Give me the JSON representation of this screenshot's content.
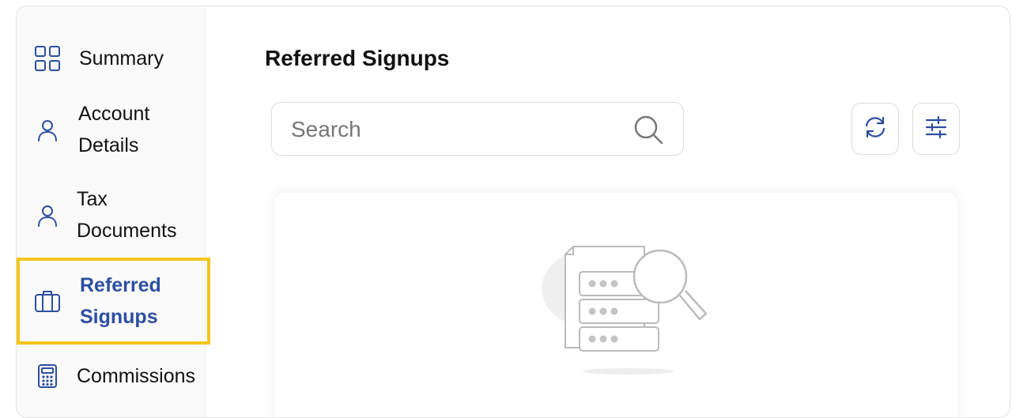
{
  "sidebar": {
    "items": [
      {
        "label": "Summary",
        "icon": "grid-icon"
      },
      {
        "label": "Account Details",
        "icon": "user-icon"
      },
      {
        "label": "Tax Documents",
        "icon": "user-icon"
      },
      {
        "label": "Referred Signups",
        "icon": "briefcase-icon",
        "active": true
      },
      {
        "label": "Commissions",
        "icon": "calculator-icon"
      }
    ]
  },
  "main": {
    "title": "Referred Signups",
    "search": {
      "placeholder": "Search",
      "value": ""
    },
    "toolbar": {
      "refresh_icon": "refresh-icon",
      "filter_icon": "sliders-icon"
    },
    "empty_state_icon": "no-data-search-icon"
  },
  "colors": {
    "accent": "#2c4fa0",
    "highlight": "#f5c518",
    "border": "#dcdcdc"
  }
}
